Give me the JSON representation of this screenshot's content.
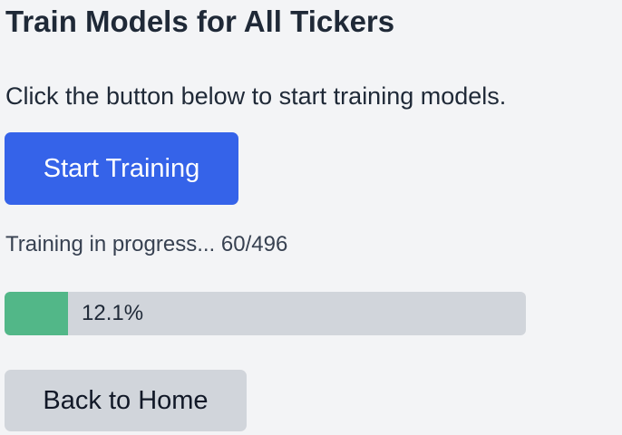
{
  "page": {
    "title": "Train Models for All Tickers",
    "instructions": "Click the button below to start training models."
  },
  "actions": {
    "start_label": "Start Training",
    "home_label": "Back to Home"
  },
  "progress": {
    "status_text": "Training in progress... 60/496",
    "completed": 60,
    "total": 496,
    "percent": 12.1,
    "percent_label": "12.1%",
    "fill_color": "#52b788",
    "track_color": "#d1d5db"
  },
  "colors": {
    "primary_button": "#3563e9",
    "secondary_button": "#d1d5db",
    "background": "#f3f4f6",
    "text": "#1f2937"
  }
}
